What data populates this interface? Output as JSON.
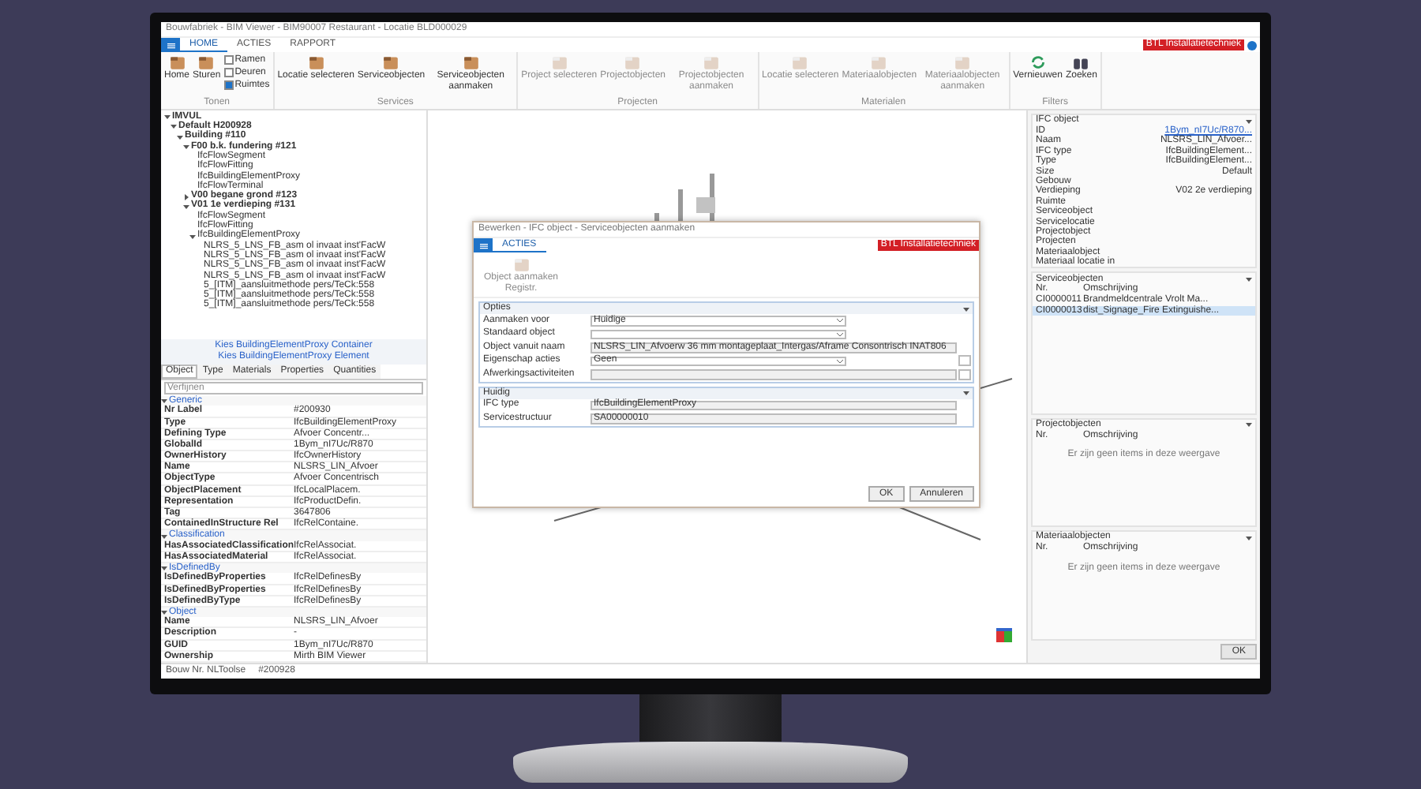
{
  "window": {
    "title": "Bouwfabriek - BIM Viewer - BIM90007 Restaurant - Locatie BLD000029"
  },
  "ribbon_tabs": [
    {
      "label": "HOME",
      "selected": true
    },
    {
      "label": "ACTIES",
      "selected": false
    },
    {
      "label": "RAPPORT",
      "selected": false
    }
  ],
  "app_badge": "BTL Installatietechniek",
  "ribbon_groups": [
    {
      "title": "Tonen",
      "items": [
        {
          "kind": "big",
          "label": "Home",
          "disabled": false
        },
        {
          "kind": "big",
          "label": "Sturen",
          "disabled": false
        },
        {
          "kind": "check",
          "label": "Ramen",
          "checked": false
        },
        {
          "kind": "check",
          "label": "Deuren",
          "checked": false
        },
        {
          "kind": "check",
          "label": "Ruimtes",
          "checked": true
        }
      ]
    },
    {
      "title": "Services",
      "items": [
        {
          "kind": "big",
          "label": "Locatie selecteren",
          "disabled": false
        },
        {
          "kind": "big",
          "label": "Serviceobjecten",
          "disabled": false
        },
        {
          "kind": "big",
          "label": "Serviceobjecten aanmaken",
          "disabled": false
        }
      ]
    },
    {
      "title": "Projecten",
      "items": [
        {
          "kind": "big",
          "label": "Project selecteren",
          "disabled": true
        },
        {
          "kind": "big",
          "label": "Projectobjecten",
          "disabled": true
        },
        {
          "kind": "big",
          "label": "Projectobjecten aanmaken",
          "disabled": true
        }
      ]
    },
    {
      "title": "Materialen",
      "items": [
        {
          "kind": "big",
          "label": "Locatie selecteren",
          "disabled": true
        },
        {
          "kind": "big",
          "label": "Materiaalobjecten",
          "disabled": true
        },
        {
          "kind": "big",
          "label": "Materiaalobjecten aanmaken",
          "disabled": true
        }
      ]
    },
    {
      "title": "Filters",
      "items": [
        {
          "kind": "refresh",
          "label": "Vernieuwen",
          "disabled": false
        },
        {
          "kind": "find",
          "label": "Zoeken",
          "disabled": false
        }
      ]
    }
  ],
  "tree": [
    {
      "label": "IMVUL",
      "bold": true,
      "expanded": true,
      "children": [
        {
          "label": "Default H200928",
          "bold": true,
          "expanded": true,
          "children": [
            {
              "label": "Building #110",
              "bold": true,
              "expanded": true,
              "children": [
                {
                  "label": "F00 b.k. fundering #121",
                  "bold": true,
                  "expanded": true,
                  "children": [
                    {
                      "label": "IfcFlowSegment",
                      "bold": false
                    },
                    {
                      "label": "IfcFlowFitting",
                      "bold": false
                    },
                    {
                      "label": "IfcBuildingElementProxy",
                      "bold": false
                    },
                    {
                      "label": "IfcFlowTerminal",
                      "bold": false
                    }
                  ]
                },
                {
                  "label": "V00 begane grond #123",
                  "bold": true,
                  "expanded": false
                },
                {
                  "label": "V01 1e verdieping #131",
                  "bold": true,
                  "expanded": true,
                  "children": [
                    {
                      "label": "IfcFlowSegment",
                      "bold": false
                    },
                    {
                      "label": "IfcFlowFitting",
                      "bold": false
                    },
                    {
                      "label": "IfcBuildingElementProxy",
                      "bold": false,
                      "expanded": true,
                      "children": [
                        {
                          "label": "NLRS_5_LNS_FB_asm ol invaat inst'FacW",
                          "bold": false
                        },
                        {
                          "label": "NLRS_5_LNS_FB_asm ol invaat inst'FacW",
                          "bold": false
                        },
                        {
                          "label": "NLRS_5_LNS_FB_asm ol invaat inst'FacW",
                          "bold": false
                        },
                        {
                          "label": "NLRS_5_LNS_FB_asm ol invaat inst'FacW",
                          "bold": false
                        },
                        {
                          "label": "5_[ITM]_aansluitmethode pers/TeCk:558",
                          "bold": false
                        },
                        {
                          "label": "5_[ITM]_aansluitmethode pers/TeCk:558",
                          "bold": false
                        },
                        {
                          "label": "5_[ITM]_aansluitmethode pers/TeCk:558",
                          "bold": false
                        }
                      ]
                    }
                  ]
                }
              ]
            }
          ]
        }
      ]
    }
  ],
  "selection_links": [
    "Kies BuildingElementProxy Container",
    "Kies BuildingElementProxy Element"
  ],
  "property_tabs": [
    {
      "label": "Object",
      "selected": true
    },
    {
      "label": "Type",
      "selected": false
    },
    {
      "label": "Materials",
      "selected": false
    },
    {
      "label": "Properties",
      "selected": false
    },
    {
      "label": "Quantities",
      "selected": false
    }
  ],
  "property_search": {
    "placeholder": "Verfijnen"
  },
  "property_sections": [
    {
      "title": "Generic",
      "expanded": true,
      "rows": [
        {
          "name": "Nr Label",
          "value": "#200930"
        },
        {
          "name": "Type",
          "value": "IfcBuildingElementProxy"
        },
        {
          "name": "Defining Type",
          "value": "Afvoer Concentr..."
        },
        {
          "name": "GlobalId",
          "value": "1Bym_nI7Uc/R870"
        },
        {
          "name": "OwnerHistory",
          "value": "IfcOwnerHistory"
        },
        {
          "name": "Name",
          "value": "NLSRS_LIN_Afvoer"
        },
        {
          "name": "ObjectType",
          "value": "Afvoer Concentrisch"
        },
        {
          "name": "ObjectPlacement",
          "value": "IfcLocalPlacem."
        },
        {
          "name": "Representation",
          "value": "IfcProductDefin."
        },
        {
          "name": "Tag",
          "value": "3647806"
        },
        {
          "name": "ContainedInStructure Rel",
          "value": "IfcRelContaine."
        }
      ]
    },
    {
      "title": "Classification",
      "expanded": true,
      "rows": [
        {
          "name": "HasAssociatedClassification",
          "value": "IfcRelAssociat."
        },
        {
          "name": "HasAssociatedMaterial",
          "value": "IfcRelAssociat."
        }
      ]
    },
    {
      "title": "IsDefinedBy",
      "expanded": true,
      "rows": [
        {
          "name": "IsDefinedByProperties",
          "value": "IfcRelDefinesBy"
        },
        {
          "name": "IsDefinedByProperties",
          "value": "IfcRelDefinesBy"
        },
        {
          "name": "IsDefinedByType",
          "value": "IfcRelDefinesBy"
        }
      ]
    },
    {
      "title": "Object",
      "expanded": true,
      "rows": [
        {
          "name": "Name",
          "value": "NLSRS_LIN_Afvoer"
        },
        {
          "name": "Description",
          "value": "-"
        },
        {
          "name": "GUID",
          "value": "1Bym_nI7Uc/R870"
        },
        {
          "name": "Ownership",
          "value": "Mirth BIM Viewer"
        }
      ]
    }
  ],
  "status_bar": [
    "Bouw Nr. NLToolse",
    "#200928"
  ],
  "dialog": {
    "title": "Bewerken - IFC object - Serviceobjecten aanmaken",
    "tabs": [
      {
        "label": "ACTIES",
        "selected": true
      }
    ],
    "badge": "BTL Installatietechniek",
    "action": {
      "label": "Object aanmaken Registr.",
      "disabled": true
    },
    "sections": [
      {
        "title": "Opties",
        "expanded": true,
        "fields": [
          {
            "kind": "select",
            "label": "Aanmaken voor",
            "value": "Huidige",
            "more": false
          },
          {
            "kind": "select",
            "label": "Standaard object",
            "more": false
          },
          {
            "kind": "text",
            "label": "Object vanuit naam",
            "value": "NLSRS_LIN_Afvoerw 36 mm montageplaat_Intergas/Aframe Consontrisch INAT806",
            "more": false
          },
          {
            "kind": "select",
            "label": "Eigenschap acties",
            "value": "Geen",
            "more": true
          },
          {
            "kind": "text",
            "label": "Afwerkingsactiviteiten",
            "more": true
          }
        ]
      },
      {
        "title": "Huidig",
        "expanded": true,
        "fields": [
          {
            "kind": "text",
            "label": "IFC type",
            "value": "IfcBuildingElementProxy",
            "more": false
          },
          {
            "kind": "text",
            "label": "Servicestructuur",
            "value": "SA00000010",
            "more": false
          }
        ]
      }
    ],
    "buttons": [
      "OK",
      "Annuleren"
    ]
  },
  "right_panel": {
    "ifc_object": {
      "title": "IFC object",
      "rows": [
        {
          "name": "ID",
          "value": "1Bym_nI7Uc/R870...",
          "link": true
        },
        {
          "name": "Naam",
          "value": "NLSRS_LIN_Afvoer...",
          "link": false
        },
        {
          "name": "IFC type",
          "value": "IfcBuildingElement...",
          "link": false
        },
        {
          "name": "Type",
          "value": "IfcBuildingElement...",
          "link": false
        },
        {
          "name": "Size",
          "value": "Default",
          "link": false
        },
        {
          "name": "Gebouw"
        },
        {
          "name": "Verdieping",
          "value": "V02 2e verdieping",
          "link": false
        },
        {
          "name": "Ruimte"
        },
        {
          "name": "Serviceobject"
        },
        {
          "name": "Servicelocatie"
        },
        {
          "name": "Projectobject"
        },
        {
          "name": "Projecten"
        },
        {
          "name": "Materiaalobject"
        },
        {
          "name": "Materiaal locatie in"
        }
      ]
    },
    "lists": [
      {
        "title": "Serviceobjecten",
        "columns": [
          "Nr.",
          "Omschrijving"
        ],
        "rows": [
          {
            "cells": [
              "CI0000011",
              "Brandmeldcentrale Vrolt Ma..."
            ],
            "selected": false
          },
          {
            "cells": [
              "CI0000013",
              "dist_Signage_Fire Extinguishe..."
            ],
            "selected": true
          }
        ]
      },
      {
        "title": "Projectobjecten",
        "columns": [
          "Nr.",
          "Omschrijving"
        ],
        "empty": "Er zijn geen items in deze weergave"
      },
      {
        "title": "Materiaalobjecten",
        "columns": [
          "Nr.",
          "Omschrijving"
        ],
        "empty": "Er zijn geen items in deze weergave"
      }
    ],
    "ok": "OK"
  }
}
